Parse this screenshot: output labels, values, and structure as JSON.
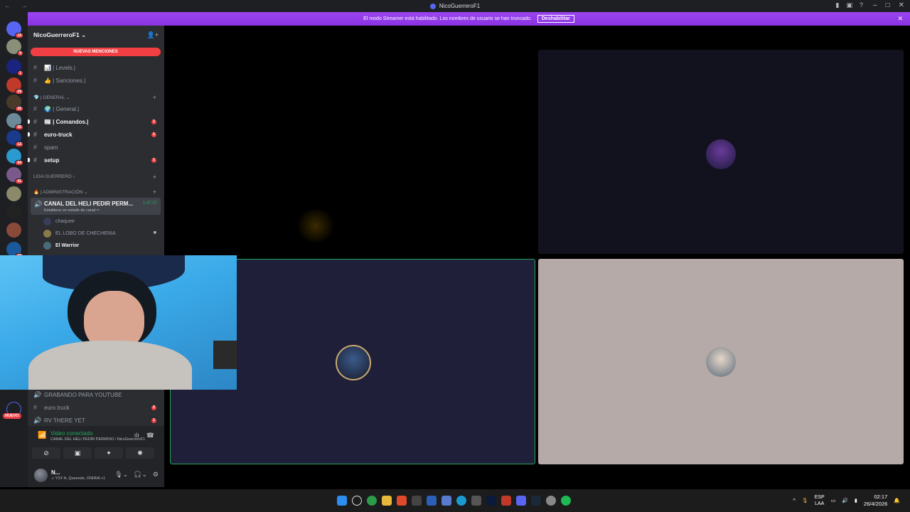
{
  "window": {
    "title": "NicoGuerreroF1"
  },
  "banner": {
    "text": "El modo Streamer está habilitado. Los nombres de usuario se han truncado.",
    "button": "Deshabilitar"
  },
  "guilds": [
    {
      "badge": "14",
      "color": "#5865f2"
    },
    {
      "badge": "9",
      "color": "#8a8f7a"
    },
    {
      "badge": "1",
      "color": "#1a237e"
    },
    {
      "badge": "29",
      "color": "#c0392b"
    },
    {
      "badge": "26",
      "color": "#4a3a2a"
    },
    {
      "badge": "55",
      "color": "#6d8a9a"
    },
    {
      "badge": "13",
      "color": "#1a3a8a"
    },
    {
      "badge": "64",
      "color": "#2a9ad0"
    },
    {
      "badge": "41",
      "color": "#7a5a8a"
    },
    {
      "badge": "",
      "color": "#8a8a6a"
    },
    {
      "badge": "",
      "color": "#222222"
    },
    {
      "badge": "",
      "color": "#8a4a3a"
    },
    {
      "badge": "27",
      "color": "#1a5a9a"
    }
  ],
  "server": {
    "name": "NicoGuerreroF1",
    "new_mentions": "NUEVAS MENCIONES"
  },
  "channels_top": [
    {
      "label": "📊 | Levels.|",
      "unread": false,
      "badge": ""
    },
    {
      "label": "👍 | Sanciones.|",
      "unread": false,
      "badge": ""
    }
  ],
  "cat_general": "💎 | GENERAL",
  "channels_general": [
    {
      "label": "🌍 | General.|",
      "unread": false,
      "badge": ""
    },
    {
      "label": "📰 | Comandos.|",
      "unread": true,
      "badge": "1"
    },
    {
      "label": "euro-truck",
      "unread": true,
      "badge": "1"
    },
    {
      "label": "spam",
      "unread": false,
      "badge": ""
    },
    {
      "label": "setup",
      "unread": true,
      "badge": "1"
    }
  ],
  "cat_liga": "LIGA GUERRERO",
  "cat_admin": "🔥 | ADMINISTRACIÓN",
  "voice_channel": {
    "name": "CANAL DEL HELI PEDIR PERM...",
    "status": "Establece un estado de canal ✏",
    "time": "1:47:37"
  },
  "voice_users": [
    {
      "name": "chaquee",
      "me": false
    },
    {
      "name": "EL LOBO DE CHECHENIA",
      "me": false
    },
    {
      "name": "El Warrior",
      "me": true
    }
  ],
  "channels_bottom": [
    {
      "label": "GRABANDO PARA YOUTUBE",
      "badge": ""
    },
    {
      "label": "euro truck",
      "badge": "2"
    },
    {
      "label": "RV THERE YET",
      "badge": "1"
    }
  ],
  "nuevo_label": "NUEVO",
  "voice_panel": {
    "title": "Video conectado",
    "subtitle": "CANAL DEL HELI PEDIR PERMISO / NicoGuerreroF1"
  },
  "user": {
    "name": "N...",
    "status": "♫ YSY A, Quevedo, ONIRIA +1"
  },
  "taskbar": {
    "lang_top": "ESP",
    "lang_bottom": "LAA",
    "time": "02:17",
    "date": "26/4/2026"
  }
}
